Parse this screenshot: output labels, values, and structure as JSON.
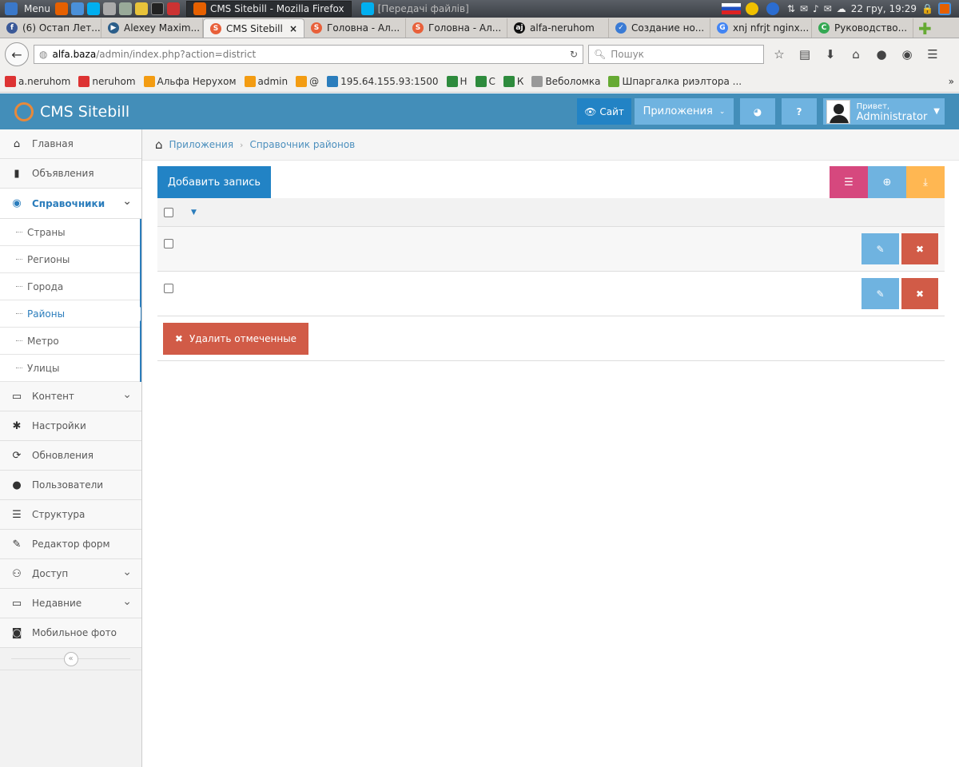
{
  "os_taskbar": {
    "menu_label": "Menu",
    "tasks": [
      {
        "label": "CMS Sitebill - Mozilla Firefox",
        "active": true
      },
      {
        "label": "[Передачі файлів]",
        "active": false
      }
    ],
    "clock": "22 гру, 19:29"
  },
  "browser": {
    "tabs": [
      {
        "label": "(6) Остап Лет...",
        "icon": "facebook-icon",
        "color": "#3b5998",
        "glyph": "f"
      },
      {
        "label": "Alexey Maxim...",
        "icon": "video-icon",
        "color": "#2b5e8a",
        "glyph": "▶"
      },
      {
        "label": "CMS Sitebill",
        "icon": "sitebill-icon",
        "color": "#e8603a",
        "glyph": "S",
        "active": true
      },
      {
        "label": "Головна - Ал...",
        "icon": "sitebill-icon",
        "color": "#e8603a",
        "glyph": "S"
      },
      {
        "label": "Головна - Ал...",
        "icon": "sitebill-icon",
        "color": "#e8603a",
        "glyph": "S"
      },
      {
        "label": "alfa-neruhom",
        "icon": "aj-icon",
        "color": "#111",
        "glyph": "aj"
      },
      {
        "label": "Создание но...",
        "icon": "check-icon",
        "color": "#3a7bd5",
        "glyph": "✓"
      },
      {
        "label": "xnj nfrjt nginx...",
        "icon": "google-icon",
        "color": "#4285f4",
        "glyph": "G"
      },
      {
        "label": "Руководство...",
        "icon": "refresh-green-icon",
        "color": "#34a853",
        "glyph": "C"
      }
    ],
    "url_host": "alfa.baza",
    "url_path": "/admin/index.php?action=district",
    "search_placeholder": "Пошук",
    "bookmarks": [
      {
        "label": "a.neruhom",
        "color": "#d33"
      },
      {
        "label": "neruhom",
        "color": "#d33"
      },
      {
        "label": "Альфа Нерухом",
        "color": "#f39c12"
      },
      {
        "label": "admin",
        "color": "#f39c12"
      },
      {
        "label": "@",
        "color": "#f39c12"
      },
      {
        "label": "195.64.155.93:1500",
        "color": "#2b7dbc"
      },
      {
        "label": "Н",
        "color": "#2e8b3d"
      },
      {
        "label": "С",
        "color": "#2e8b3d"
      },
      {
        "label": "К",
        "color": "#2e8b3d"
      },
      {
        "label": "Веболомка",
        "color": "#999"
      },
      {
        "label": "Шпаргалка риэлтора ...",
        "color": "#6a3"
      }
    ]
  },
  "app": {
    "brand": "CMS Sitebill",
    "site_label": "Сайт",
    "apps_label": "Приложения",
    "greeting": "Привет,",
    "username": "Administrator"
  },
  "sidebar": {
    "items": [
      {
        "label": "Главная",
        "icon": "home-icon",
        "glyph": "⌂"
      },
      {
        "label": "Объявления",
        "icon": "book-icon",
        "glyph": "▮"
      }
    ],
    "open_item": {
      "label": "Справочники",
      "icon": "globe-icon",
      "glyph": "◉"
    },
    "subitems": [
      "Страны",
      "Регионы",
      "Города",
      "Районы",
      "Метро",
      "Улицы"
    ],
    "active_subitem": "Районы",
    "items_after": [
      {
        "label": "Контент",
        "icon": "desktop-icon",
        "glyph": "▭",
        "chevron": true
      },
      {
        "label": "Настройки",
        "icon": "cog-icon",
        "glyph": "✱",
        "chevron": false
      },
      {
        "label": "Обновления",
        "icon": "refresh-icon",
        "glyph": "⟳",
        "chevron": false
      },
      {
        "label": "Пользователи",
        "icon": "user-icon",
        "glyph": "●",
        "chevron": false
      },
      {
        "label": "Структура",
        "icon": "list-icon",
        "glyph": "☰",
        "chevron": false
      },
      {
        "label": "Редактор форм",
        "icon": "edit-icon",
        "glyph": "✎",
        "chevron": false
      },
      {
        "label": "Доступ",
        "icon": "group-icon",
        "glyph": "⚇",
        "chevron": true
      },
      {
        "label": "Недавние",
        "icon": "monitor-icon",
        "glyph": "▭",
        "chevron": true
      },
      {
        "label": "Мобильное фото",
        "icon": "camera-icon",
        "glyph": "◙",
        "chevron": false
      }
    ]
  },
  "breadcrumb": {
    "items": [
      "Приложения",
      "Справочник районов"
    ]
  },
  "main": {
    "add_label": "Добавить запись",
    "delete_selected_label": "Удалить отмеченные",
    "rows": [
      {
        "checked": false
      },
      {
        "checked": false
      }
    ]
  }
}
